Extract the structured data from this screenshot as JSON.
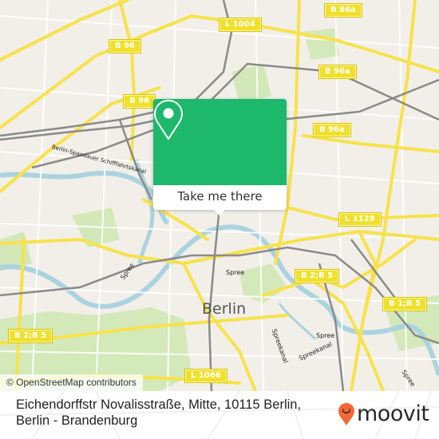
{
  "map": {
    "city_label": "Berlin",
    "attribution": "© OpenStreetMap contributors",
    "road_labels": [
      {
        "id": "l1004",
        "text": "L 1004"
      },
      {
        "id": "b96a-top",
        "text": "B 96a"
      },
      {
        "id": "b96-1",
        "text": "B 96"
      },
      {
        "id": "b96-2",
        "text": "B 96"
      },
      {
        "id": "b96a-mid",
        "text": "B 96a"
      },
      {
        "id": "b96a-right",
        "text": "B 96a"
      },
      {
        "id": "l1129",
        "text": "L 1129"
      },
      {
        "id": "b2b5-center",
        "text": "B 2;B 5"
      },
      {
        "id": "b1b5",
        "text": "B 1;B 5"
      },
      {
        "id": "b2b5-left",
        "text": "B 2;B 5"
      },
      {
        "id": "l1066",
        "text": "L 1066"
      }
    ],
    "water_labels": [
      {
        "id": "spree-1",
        "text": "Spree"
      },
      {
        "id": "spree-2",
        "text": "Spree"
      },
      {
        "id": "spree-3",
        "text": "Spree"
      },
      {
        "id": "spree-4",
        "text": "Spree"
      },
      {
        "id": "spreekanal-1",
        "text": "Spreekanal"
      },
      {
        "id": "spreekanal-2",
        "text": "Spreekanal"
      },
      {
        "id": "canal",
        "text": "Berlin-Spandauer Schifffahrtskanal"
      }
    ]
  },
  "popup": {
    "icon": "map-pin-icon",
    "cta_label": "Take me there",
    "accent_color": "#1db86b"
  },
  "footer": {
    "address_line": "Eichendorffstr Novalisstraße, Mitte, 10115 Berlin, Berlin - Brandenburg",
    "logo": {
      "icon": "moovit-pin-icon",
      "text": "moovit",
      "pin_color": "#f26a36"
    }
  }
}
